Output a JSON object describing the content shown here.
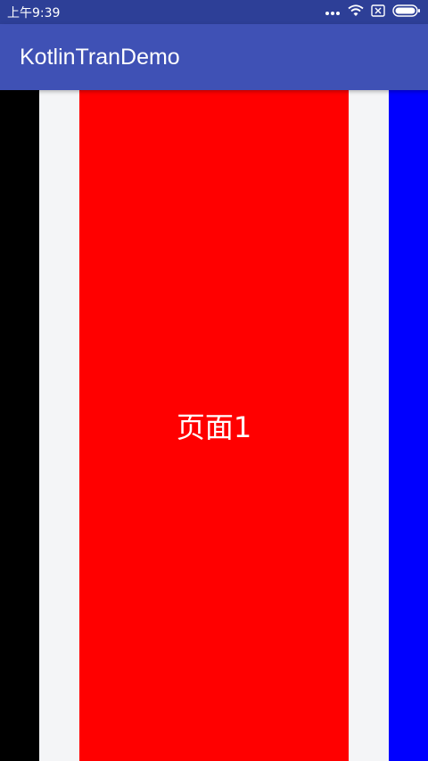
{
  "status_bar": {
    "time": "上午9:39",
    "icons": [
      "more-dots-icon",
      "wifi-icon",
      "sim-x-icon",
      "battery-icon"
    ],
    "background": "#2d3f97"
  },
  "app_bar": {
    "title": "KotlinTranDemo",
    "background": "#3f51b5"
  },
  "pager": {
    "background": "#f4f5f7",
    "pages": [
      {
        "position": "previous",
        "color": "#000000",
        "label": ""
      },
      {
        "position": "current",
        "color": "#ff0000",
        "label": "页面1"
      },
      {
        "position": "next",
        "color": "#0000ff",
        "label": ""
      }
    ]
  }
}
